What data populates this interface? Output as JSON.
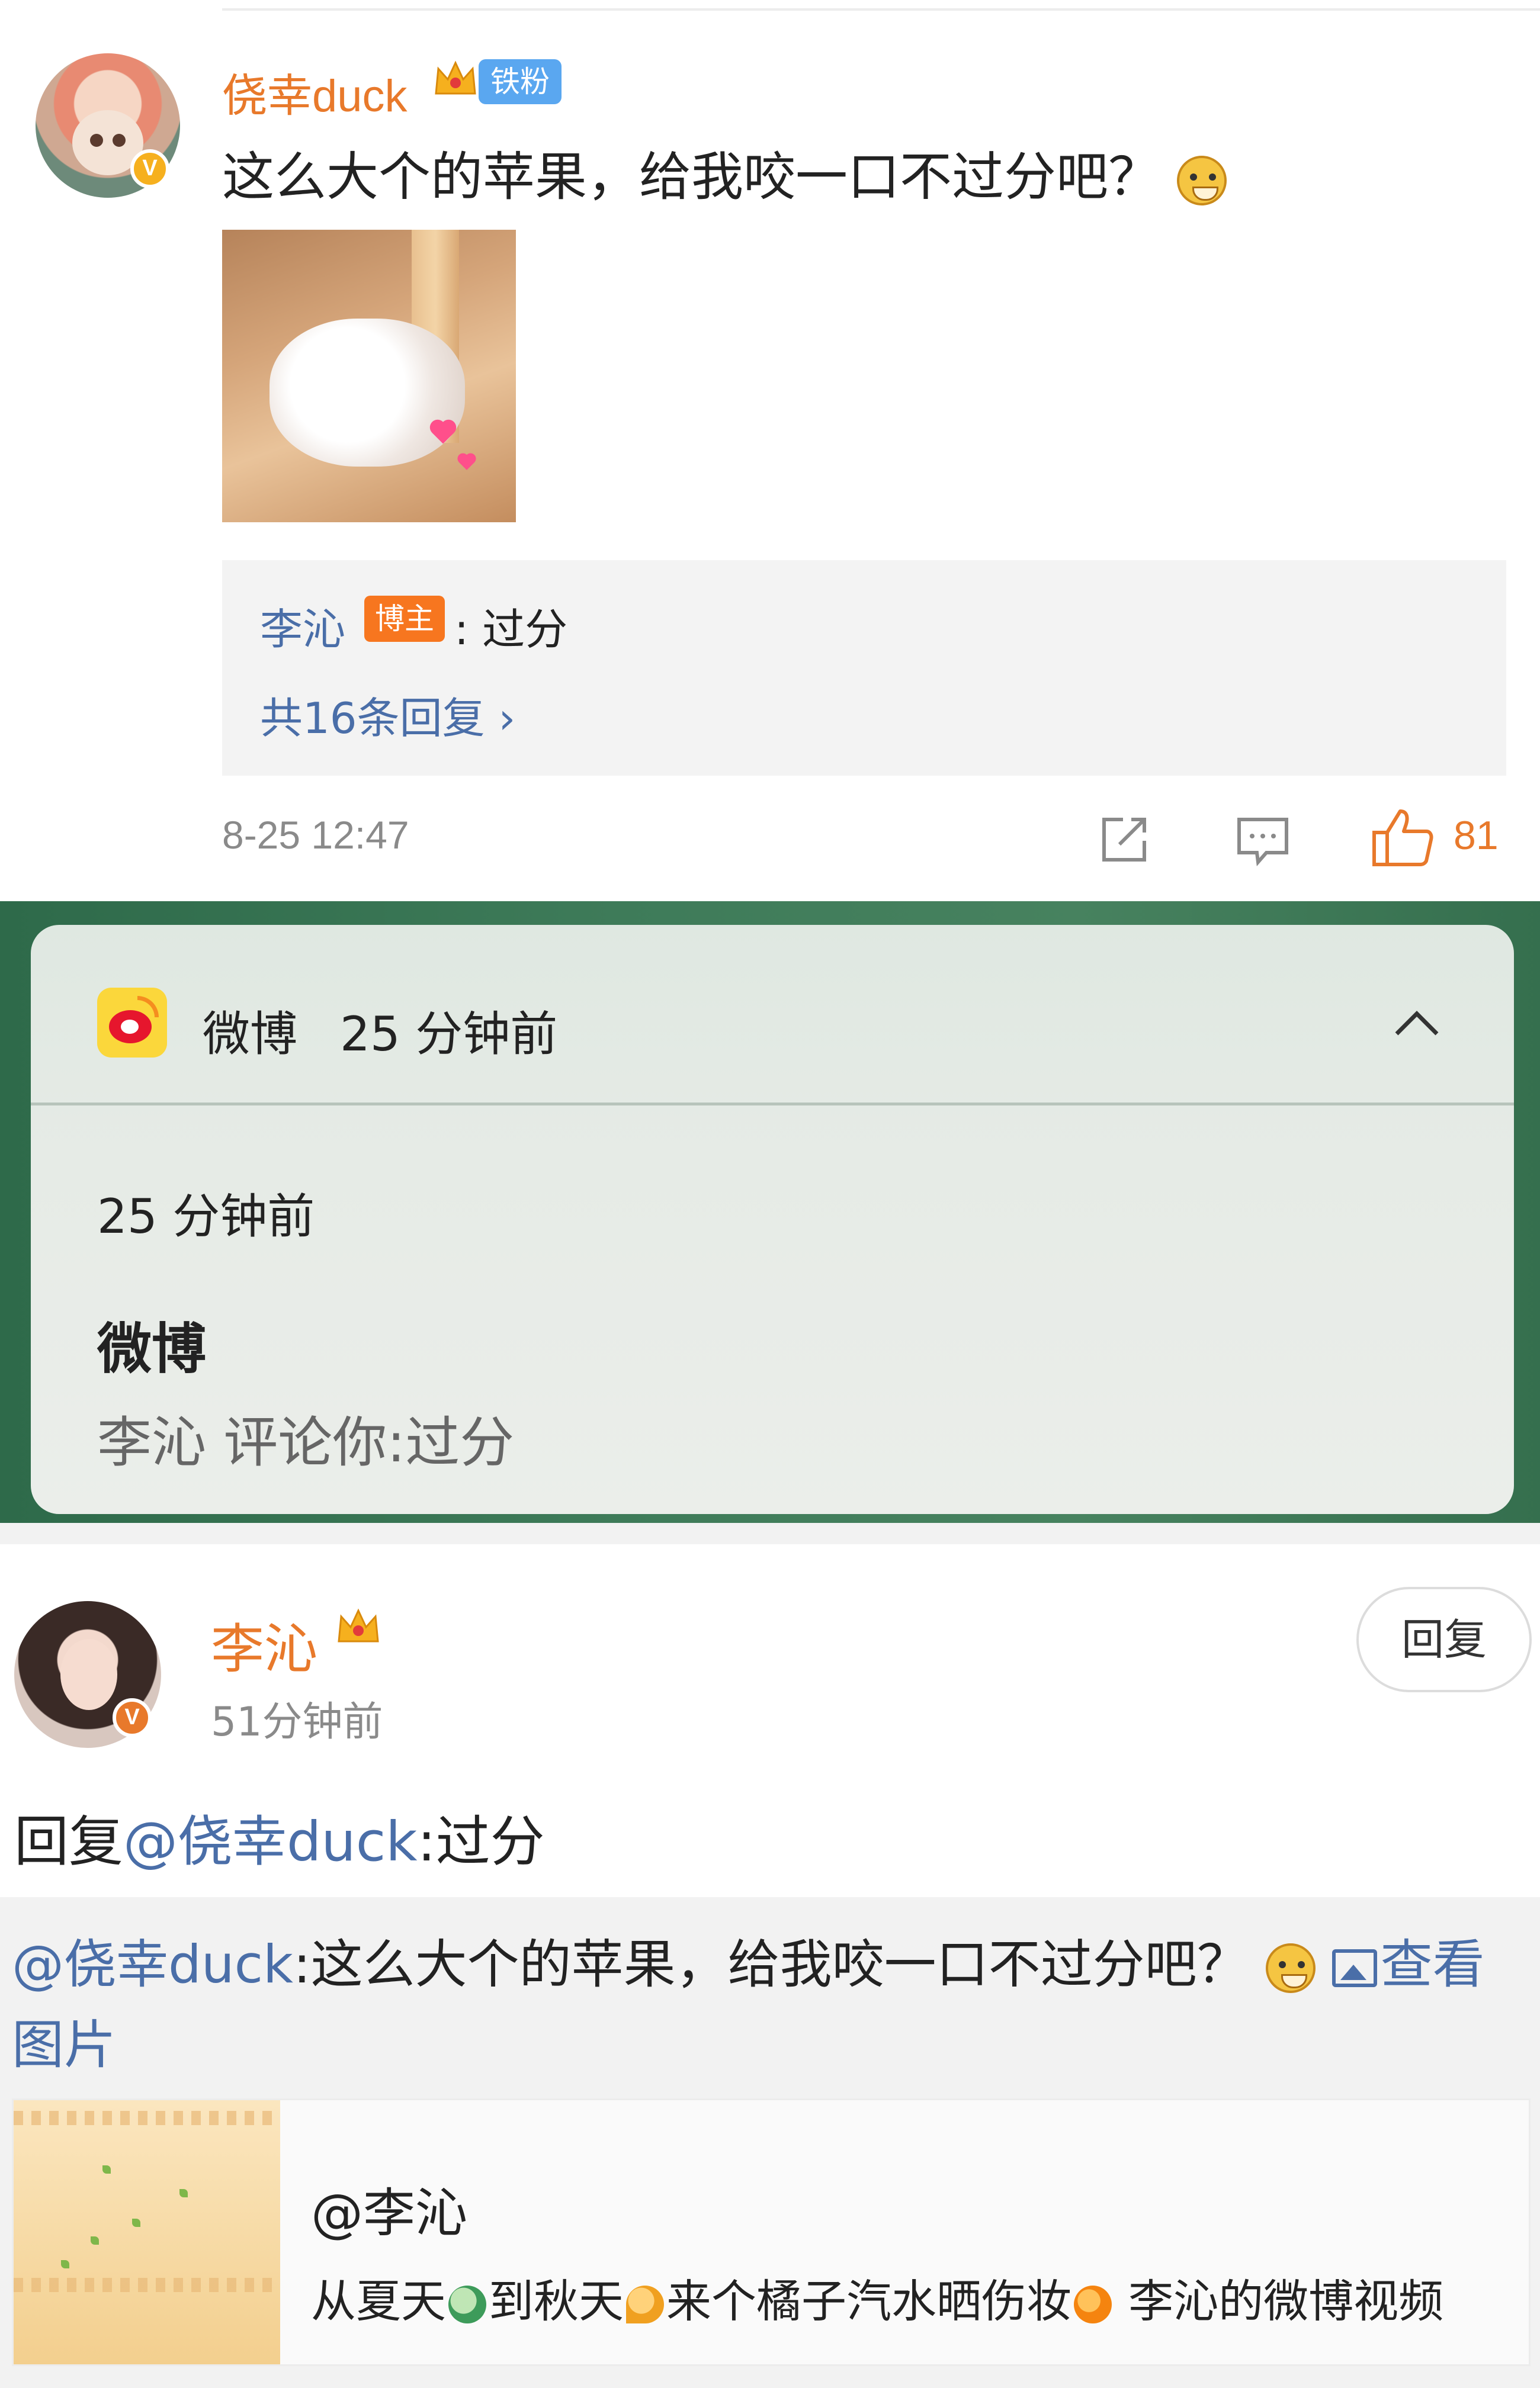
{
  "comment": {
    "username": "侥幸duck",
    "fan_badge": "铁粉",
    "text": "这么大个的苹果，给我咬一口不过分吧？",
    "verified_mark": "V",
    "reply_box": {
      "replier": "李沁",
      "host_badge": "博主",
      "reply_text": ": 过分",
      "more_replies": "共16条回复 ›"
    },
    "timestamp": "8-25 12:47",
    "like_count": "81"
  },
  "notification": {
    "app_name": "微博",
    "header_time": "25 分钟前",
    "time": "25 分钟前",
    "title": "微博",
    "body": "李沁 评论你:过分"
  },
  "reply_detail": {
    "username": "李沁",
    "verified_mark": "V",
    "time": "51分钟前",
    "reply_button": "回复",
    "reply_prefix": "回复",
    "reply_mention": "@侥幸duck",
    "reply_text": ":过分",
    "quote_mention": "@侥幸duck",
    "quote_text": ":这么大个的苹果，给我咬一口不过分吧？",
    "view_image": "查看图片",
    "card_title": "@李沁",
    "card_desc_1": "从夏天",
    "card_desc_2": "到秋天",
    "card_desc_3": "来个橘子汽水晒伤妆",
    "card_desc_4": " 李沁的微博视频"
  },
  "colors": {
    "accent_orange": "#e8792b",
    "link_blue": "#4a6ea8",
    "badge_blue": "#5aa7f0",
    "host_badge": "#f7761f",
    "notification_bg": "#3e7b59"
  },
  "icons": [
    "crown-icon",
    "doge-emoji",
    "share-icon",
    "comment-icon",
    "like-icon",
    "weibo-logo-icon",
    "chevron-up-icon",
    "image-icon"
  ]
}
